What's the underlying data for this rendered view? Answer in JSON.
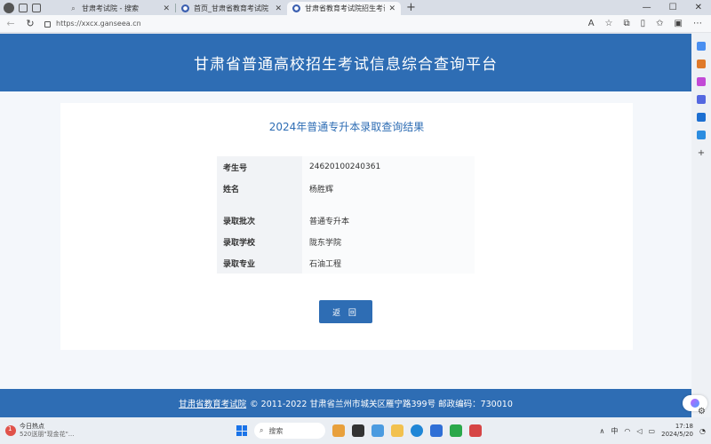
{
  "browser": {
    "tabs": [
      {
        "label": "甘肃考试院 - 搜索",
        "favicon": "search-icon",
        "active": false
      },
      {
        "label": "首页_甘肃省教育考试院",
        "favicon": "site-icon",
        "active": false
      },
      {
        "label": "甘肃省教育考试院招生考试信息",
        "favicon": "site-icon",
        "active": true
      }
    ],
    "new_tab": "+",
    "url": "https://xxcx.ganseea.cn"
  },
  "page": {
    "header_title": "甘肃省普通高校招生考试信息综合查询平台",
    "result_title": "2024年普通专升本录取查询结果",
    "rows": [
      {
        "key": "考生号",
        "value": "24620100240361"
      },
      {
        "key": "姓名",
        "value": "杨胜辉"
      },
      {
        "key": "录取批次",
        "value": "普通专升本"
      },
      {
        "key": "录取学校",
        "value": "陇东学院"
      },
      {
        "key": "录取专业",
        "value": "石油工程"
      }
    ],
    "back_button": "返 回",
    "footer_link": "甘肃省教育考试院",
    "footer_text": "© 2011-2022 甘肃省兰州市城关区雁宁路399号 邮政编码：730010"
  },
  "taskbar": {
    "news_title": "今日热点",
    "news_sub": "520送朋\"现金花\"...",
    "news_badge": "1",
    "search_placeholder": "搜索",
    "tray_lang": "中",
    "time": "17:18",
    "date": "2024/5/20"
  },
  "colors": {
    "brand_blue": "#2e6db4",
    "card_bg": "#ffffff",
    "page_bg": "#f4f7fb"
  }
}
